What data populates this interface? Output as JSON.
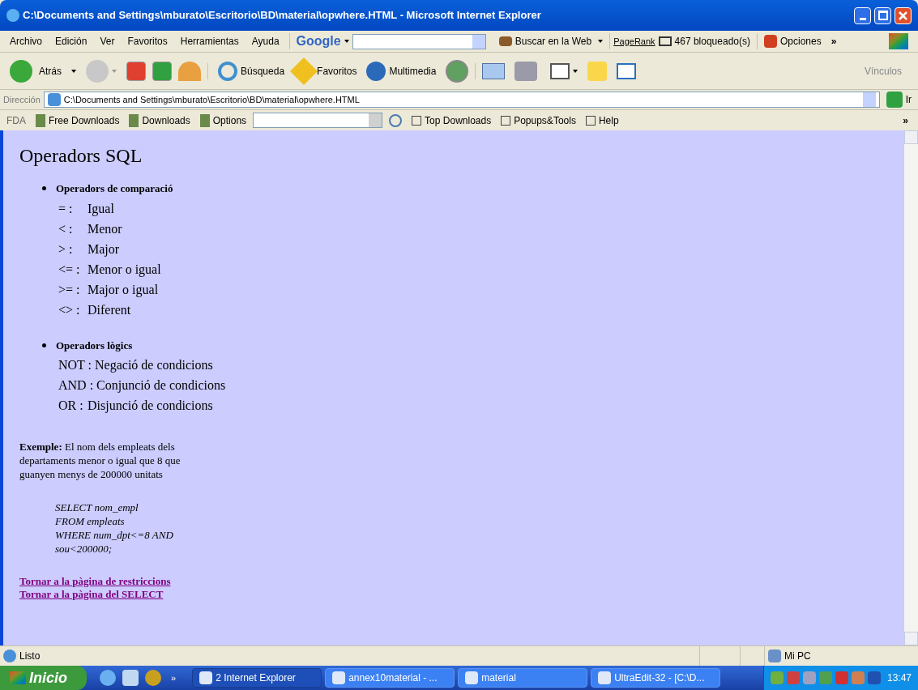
{
  "window": {
    "title": "C:\\Documents and Settings\\mburato\\Escritorio\\BD\\material\\opwhere.HTML - Microsoft Internet Explorer"
  },
  "menu_bar": [
    "Archivo",
    "Edición",
    "Ver",
    "Favoritos",
    "Herramientas",
    "Ayuda"
  ],
  "google_toolbar": {
    "logo": "Google",
    "search_button": "Buscar en la Web",
    "pagerank": "PageRank",
    "blocked": "467 bloqueado(s)",
    "options": "Opciones",
    "more": "»"
  },
  "nav_toolbar": {
    "back": "Atrás",
    "search": "Búsqueda",
    "favorites": "Favoritos",
    "media": "Multimedia",
    "links": "Vínculos"
  },
  "address_bar": {
    "label": "Dirección",
    "value": "C:\\Documents and Settings\\mburato\\Escritorio\\BD\\material\\opwhere.HTML",
    "go": "Ir"
  },
  "fda_toolbar": {
    "label": "FDA",
    "items": [
      "Free Downloads",
      "Downloads",
      "Options"
    ],
    "items_after": [
      "Top Downloads",
      "Popups&Tools",
      "Help"
    ],
    "more": "»"
  },
  "page": {
    "heading": "Operadors SQL",
    "sections": [
      {
        "title": "Operadors de comparació",
        "items": [
          {
            "op": "= :",
            "desc": "Igual"
          },
          {
            "op": "< :",
            "desc": "Menor"
          },
          {
            "op": "> :",
            "desc": "Major"
          },
          {
            "op": "<= :",
            "desc": "Menor o igual"
          },
          {
            "op": ">= :",
            "desc": "Major o igual"
          },
          {
            "op": "<> :",
            "desc": "Diferent"
          }
        ]
      },
      {
        "title": "Operadors lògics",
        "items": [
          {
            "op": "NOT :",
            "desc": "Negació de condicions"
          },
          {
            "op": "AND :",
            "desc": "Conjunció de condicions"
          },
          {
            "op": "OR :",
            "desc": "Disjunció de condicions"
          }
        ]
      }
    ],
    "example": "**Exemple:** El nom dels empleats dels departaments menor o igual que 8 que guanyen menys de 200000 unitats",
    "code": [
      "SELECT nom_empl",
      "FROM empleats",
      "WHERE num_dpt<=8 AND",
      "sou<200000;"
    ],
    "links": [
      "Tornar a la pàgina de restriccions",
      "Tornar a la pàgina del SELECT"
    ]
  },
  "status_bar": {
    "status": "Listo",
    "zone": "Mi PC"
  },
  "taskbar": {
    "start": "Inicio",
    "more": "»",
    "tasks": [
      {
        "label": "2 Internet Explorer",
        "selected": true
      },
      {
        "label": "annex10material - ...",
        "selected": false
      },
      {
        "label": "material",
        "selected": false
      },
      {
        "label": "UltraEdit-32 - [C:\\D...",
        "selected": false
      }
    ],
    "clock": "13:47"
  }
}
